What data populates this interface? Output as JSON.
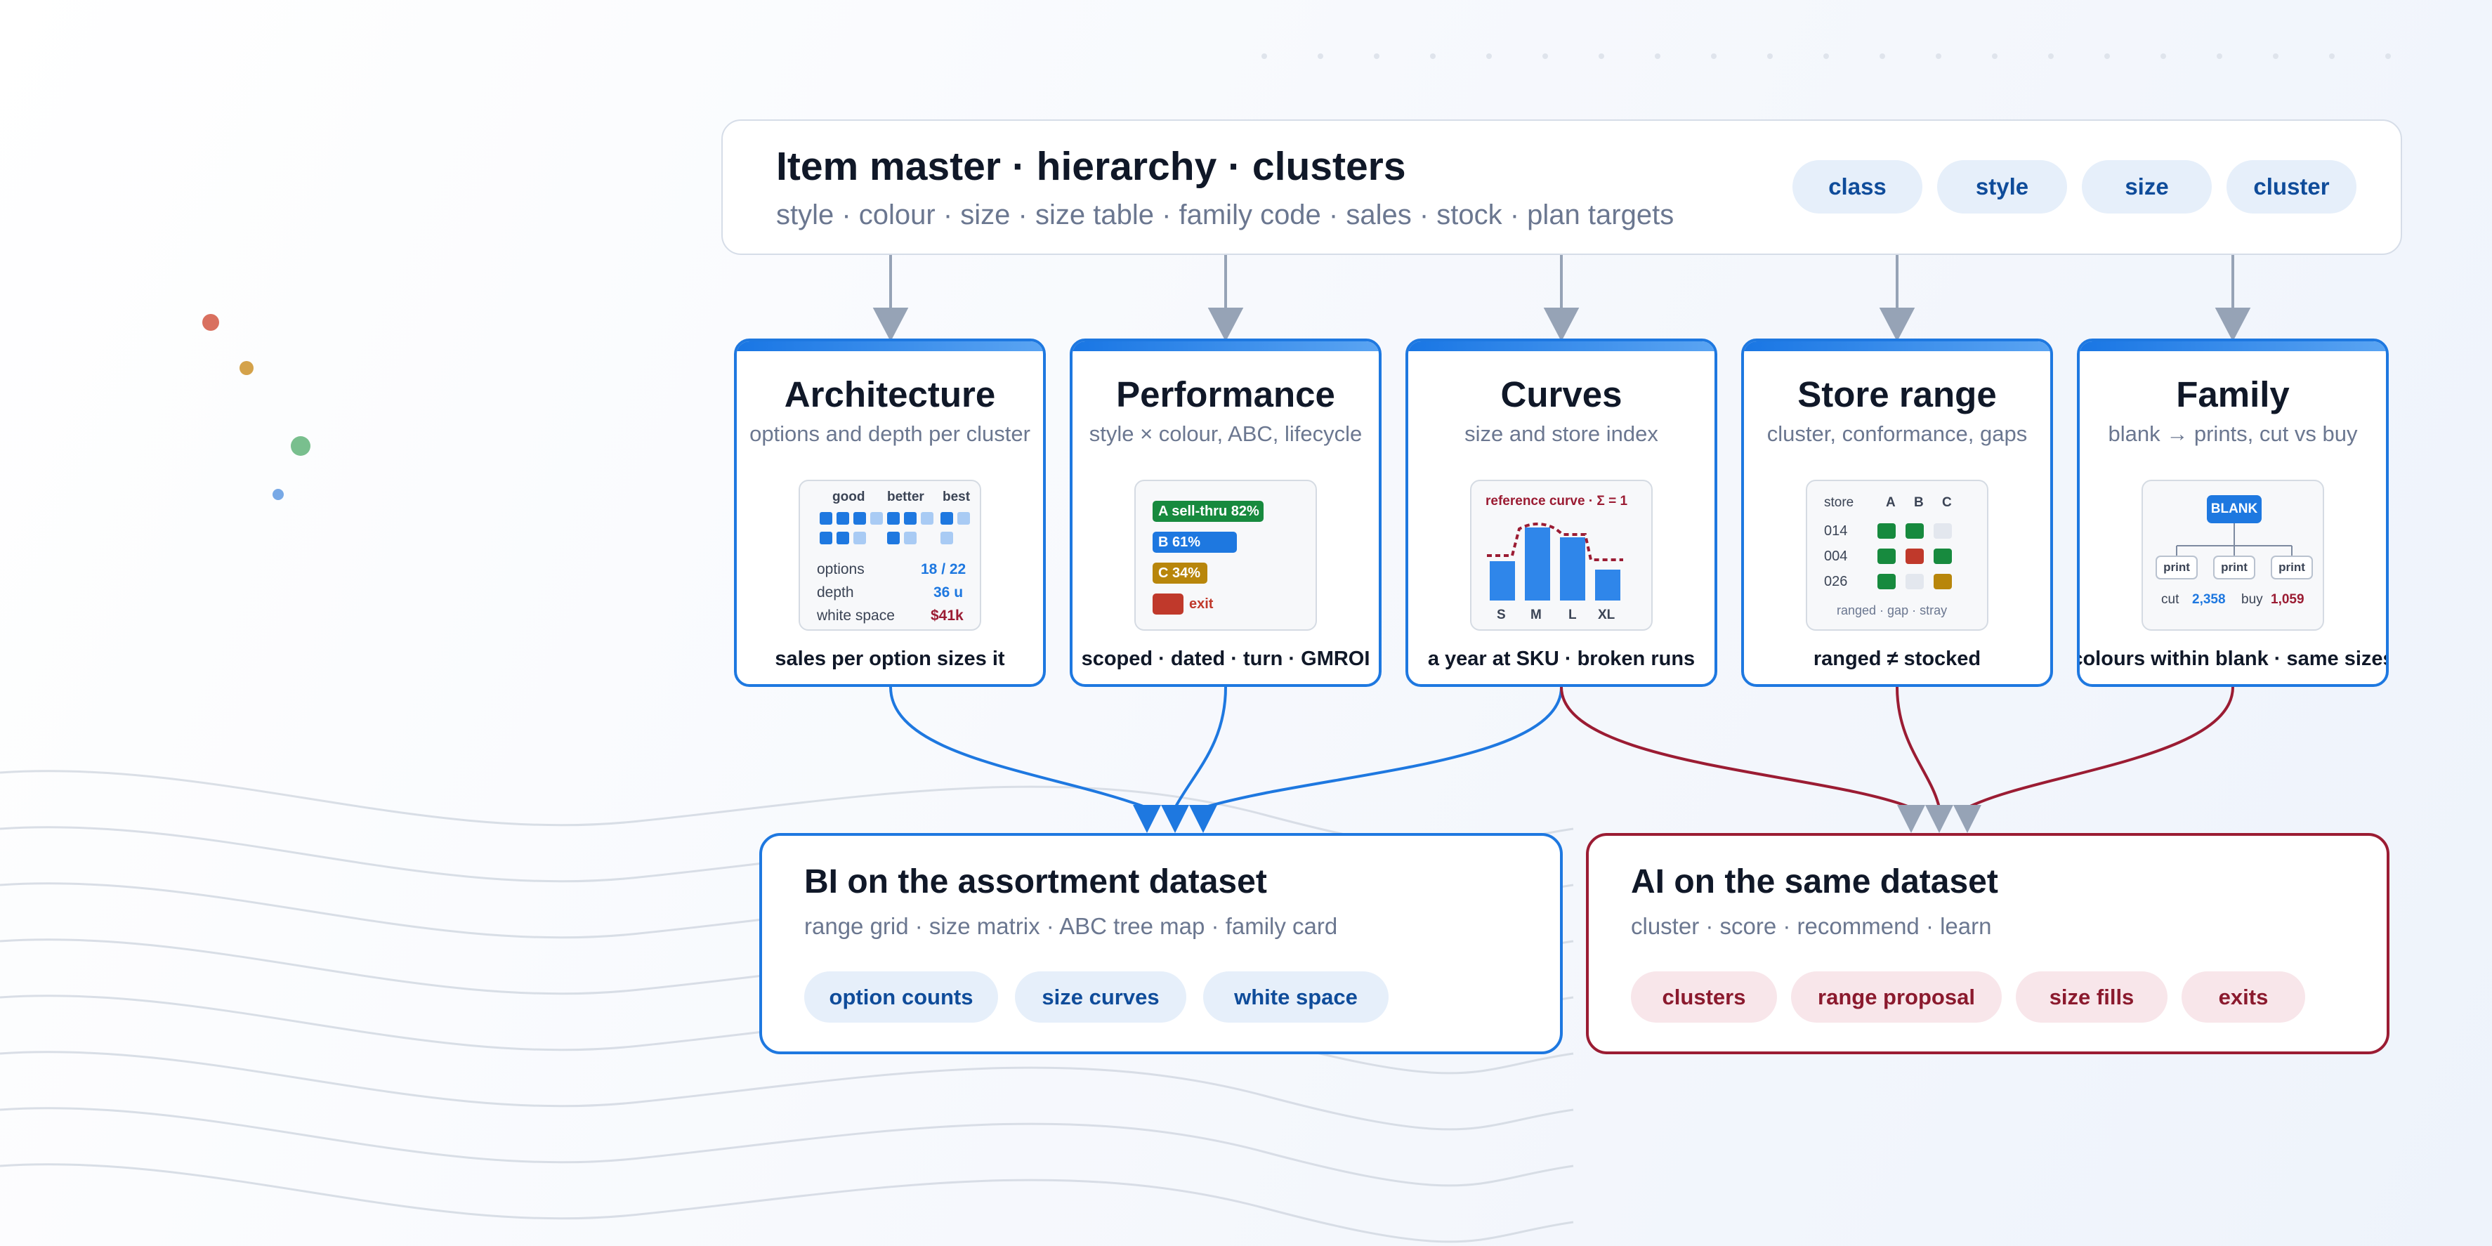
{
  "colors": {
    "blue": "#1e78e0",
    "red": "#9b1c33",
    "gray_connector": "#96a3b6",
    "green": "#178a3e",
    "amber": "#b8860b",
    "exit_red": "#c0392b"
  },
  "header": {
    "title": "Item master · hierarchy · clusters",
    "subtitle": "style · colour · size · size table · family code · sales · stock · plan targets",
    "chips": [
      "class",
      "style",
      "size",
      "cluster"
    ]
  },
  "modules": [
    {
      "title": "Architecture",
      "subtitle": "options and depth per cluster",
      "footer": "sales per option sizes it",
      "mini": {
        "columns": [
          "good",
          "better",
          "best"
        ],
        "rows": [
          {
            "label": "options",
            "value": "18 / 22"
          },
          {
            "label": "depth",
            "value": "36 u"
          },
          {
            "label": "white space",
            "value": "$41k"
          }
        ]
      }
    },
    {
      "title": "Performance",
      "subtitle": "style × colour, ABC, lifecycle",
      "footer": "scoped · dated · turn · GMROI",
      "mini": {
        "bars": [
          {
            "label": "A sell-thru 82%",
            "color": "#178a3e"
          },
          {
            "label": "B 61%",
            "color": "#1e78e0"
          },
          {
            "label": "C 34%",
            "color": "#b8860b"
          },
          {
            "label": "exit",
            "color": "#c0392b"
          }
        ]
      }
    },
    {
      "title": "Curves",
      "subtitle": "size and store index",
      "footer": "a year at SKU · broken runs",
      "mini": {
        "label": "reference curve · Σ = 1",
        "sizes": [
          "S",
          "M",
          "L",
          "XL"
        ]
      }
    },
    {
      "title": "Store range",
      "subtitle": "cluster, conformance, gaps",
      "footer": "ranged ≠ stocked",
      "mini": {
        "header": [
          "store",
          "A",
          "B",
          "C"
        ],
        "stores": [
          "014",
          "004",
          "026"
        ],
        "legend": "ranged · gap · stray"
      }
    },
    {
      "title": "Family",
      "subtitle": "blank → prints, cut vs buy",
      "footer": "colours within blank · same sizes",
      "mini": {
        "root": "BLANK",
        "children": [
          "print",
          "print",
          "print"
        ],
        "cut_label": "cut",
        "cut_value": "2,358",
        "buy_label": "buy",
        "buy_value": "1,059"
      }
    }
  ],
  "bi": {
    "title": "BI on the assortment dataset",
    "subtitle": "range grid · size matrix · ABC tree map · family card",
    "chips": [
      "option counts",
      "size curves",
      "white space"
    ]
  },
  "ai": {
    "title": "AI on the same dataset",
    "subtitle": "cluster · score · recommend · learn",
    "chips": [
      "clusters",
      "range proposal",
      "size fills",
      "exits"
    ]
  }
}
